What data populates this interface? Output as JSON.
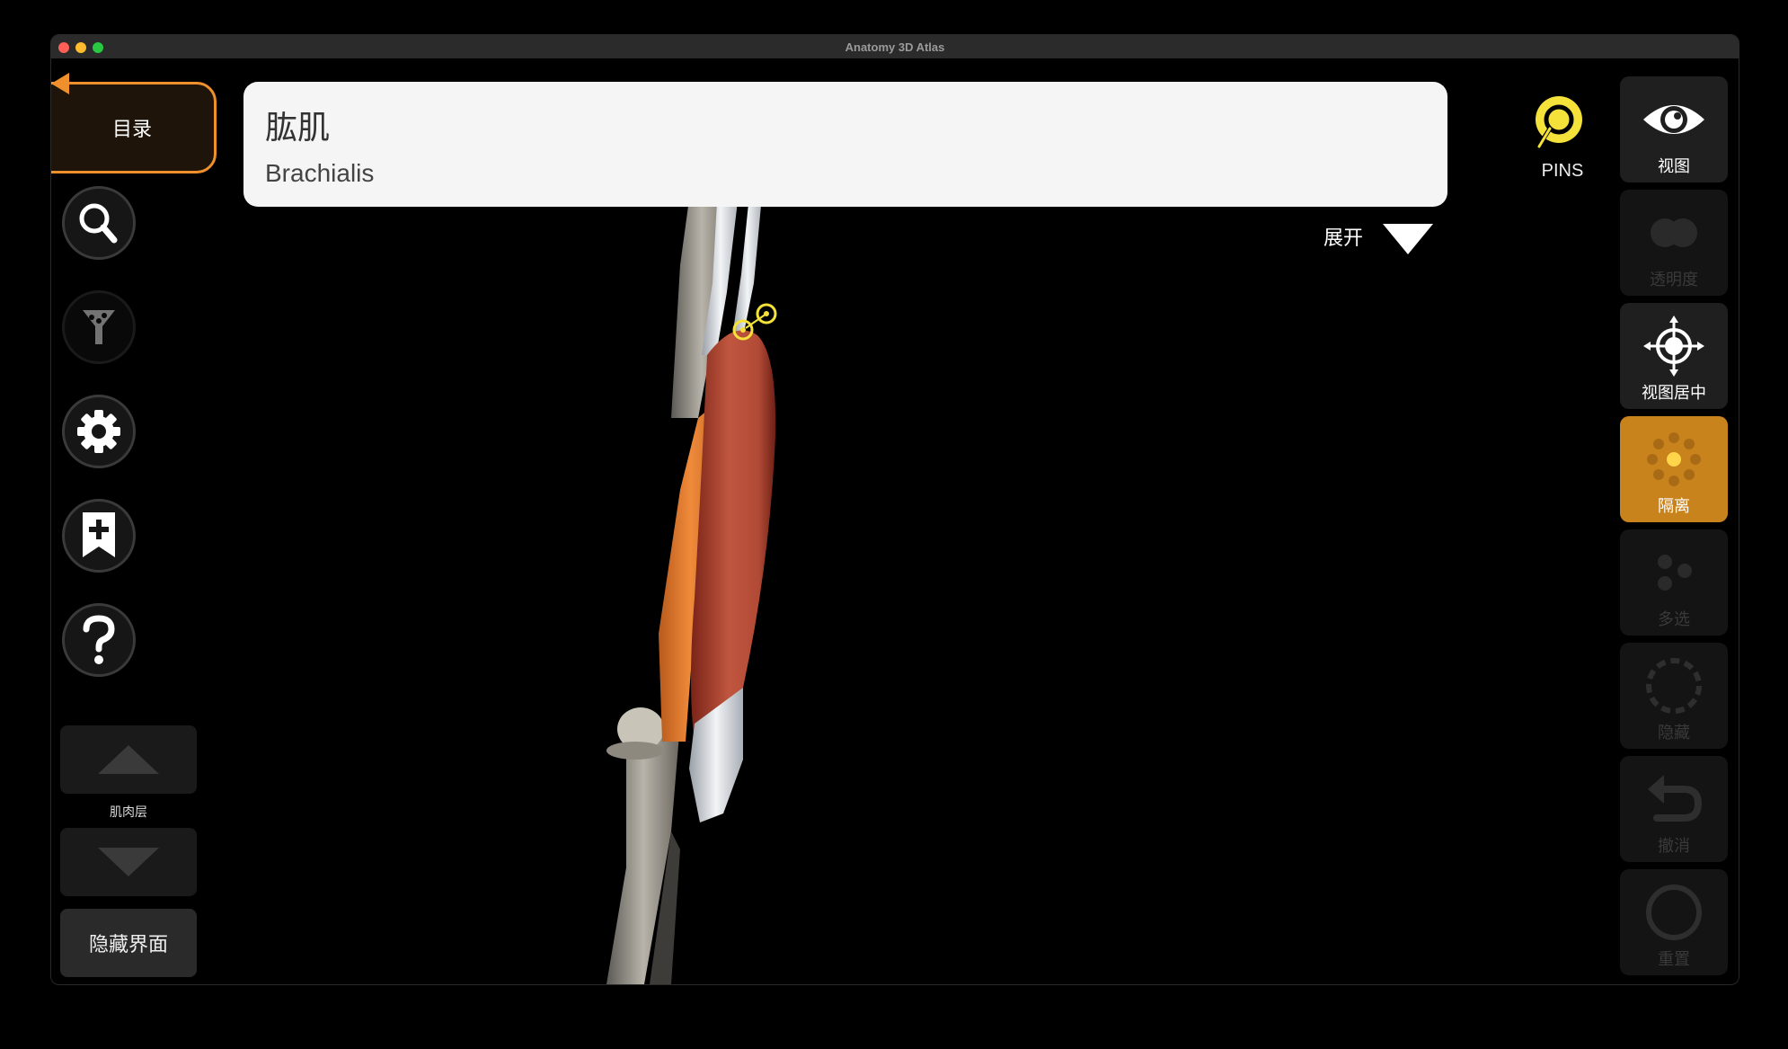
{
  "window": {
    "title": "Anatomy 3D Atlas"
  },
  "sidebar": {
    "catalog_label": "目录",
    "buttons": [
      {
        "name": "search",
        "icon": "search-icon"
      },
      {
        "name": "filter",
        "icon": "filter-icon"
      },
      {
        "name": "settings",
        "icon": "gear-icon"
      },
      {
        "name": "bookmark",
        "icon": "bookmark-add-icon"
      },
      {
        "name": "help",
        "icon": "help-icon"
      }
    ],
    "layer_label": "肌肉层",
    "hide_ui_label": "隐藏界面"
  },
  "structure": {
    "name_zh": "肱肌",
    "name_en": "Brachialis",
    "expand_label": "展开"
  },
  "pins": {
    "label": "PINS",
    "icon": "pin-icon"
  },
  "toolbar": {
    "view": "视图",
    "opacity": "透明度",
    "center": "视图居中",
    "isolate": "隔离",
    "multi_select": "多选",
    "hide": "隐藏",
    "undo": "撤消",
    "reset": "重置"
  },
  "colors": {
    "accent_orange": "#f0902c",
    "isolate_active": "#c9831c",
    "pin_yellow": "#f4e23a"
  }
}
